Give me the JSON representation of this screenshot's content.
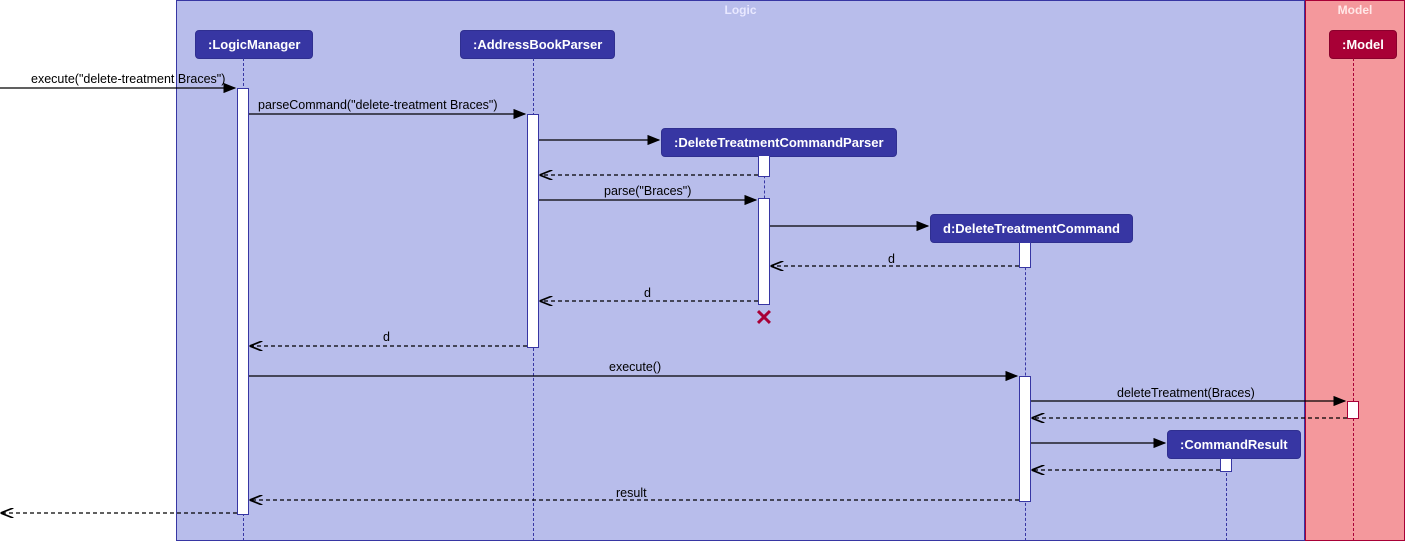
{
  "frames": {
    "logic": "Logic",
    "model": "Model"
  },
  "participants": {
    "logicManager": ":LogicManager",
    "addressBookParser": ":AddressBookParser",
    "deleteTreatmentCommandParser": ":DeleteTreatmentCommandParser",
    "deleteTreatmentCommand": "d:DeleteTreatmentCommand",
    "commandResult": ":CommandResult",
    "model": ":Model"
  },
  "messages": {
    "m1": "execute(\"delete-treatment Braces\")",
    "m2": "parseCommand(\"delete-treatment Braces\")",
    "m3": "parse(\"Braces\")",
    "m4": "d",
    "m5": "d",
    "m6": "d",
    "m7": "execute()",
    "m8": "deleteTreatment(Braces)",
    "m9": "result"
  },
  "chart_data": {
    "type": "uml-sequence",
    "frames": [
      {
        "name": "Logic",
        "color": "#b8bdeb",
        "contains": [
          ":LogicManager",
          ":AddressBookParser",
          ":DeleteTreatmentCommandParser",
          "d:DeleteTreatmentCommand",
          ":CommandResult"
        ]
      },
      {
        "name": "Model",
        "color": "#f4989c",
        "contains": [
          ":Model"
        ]
      }
    ],
    "participants": [
      {
        "id": "caller",
        "label": "",
        "external": true
      },
      {
        "id": "LM",
        "label": ":LogicManager"
      },
      {
        "id": "ABP",
        "label": ":AddressBookParser"
      },
      {
        "id": "DTCP",
        "label": ":DeleteTreatmentCommandParser",
        "created": true,
        "destroyed": true
      },
      {
        "id": "DTC",
        "label": "d:DeleteTreatmentCommand",
        "created": true
      },
      {
        "id": "CR",
        "label": ":CommandResult",
        "created": true
      },
      {
        "id": "M",
        "label": ":Model"
      }
    ],
    "messages": [
      {
        "from": "caller",
        "to": "LM",
        "label": "execute(\"delete-treatment Braces\")",
        "type": "sync"
      },
      {
        "from": "LM",
        "to": "ABP",
        "label": "parseCommand(\"delete-treatment Braces\")",
        "type": "sync"
      },
      {
        "from": "ABP",
        "to": "DTCP",
        "label": "",
        "type": "create"
      },
      {
        "from": "DTCP",
        "to": "ABP",
        "label": "",
        "type": "return"
      },
      {
        "from": "ABP",
        "to": "DTCP",
        "label": "parse(\"Braces\")",
        "type": "sync"
      },
      {
        "from": "DTCP",
        "to": "DTC",
        "label": "",
        "type": "create"
      },
      {
        "from": "DTC",
        "to": "DTCP",
        "label": "d",
        "type": "return"
      },
      {
        "from": "DTCP",
        "to": "ABP",
        "label": "d",
        "type": "return"
      },
      {
        "from": "DTCP",
        "to": null,
        "label": "",
        "type": "destroy"
      },
      {
        "from": "ABP",
        "to": "LM",
        "label": "d",
        "type": "return"
      },
      {
        "from": "LM",
        "to": "DTC",
        "label": "execute()",
        "type": "sync"
      },
      {
        "from": "DTC",
        "to": "M",
        "label": "deleteTreatment(Braces)",
        "type": "sync"
      },
      {
        "from": "M",
        "to": "DTC",
        "label": "",
        "type": "return"
      },
      {
        "from": "DTC",
        "to": "CR",
        "label": "",
        "type": "create"
      },
      {
        "from": "CR",
        "to": "DTC",
        "label": "",
        "type": "return"
      },
      {
        "from": "DTC",
        "to": "LM",
        "label": "result",
        "type": "return"
      },
      {
        "from": "LM",
        "to": "caller",
        "label": "",
        "type": "return"
      }
    ]
  }
}
